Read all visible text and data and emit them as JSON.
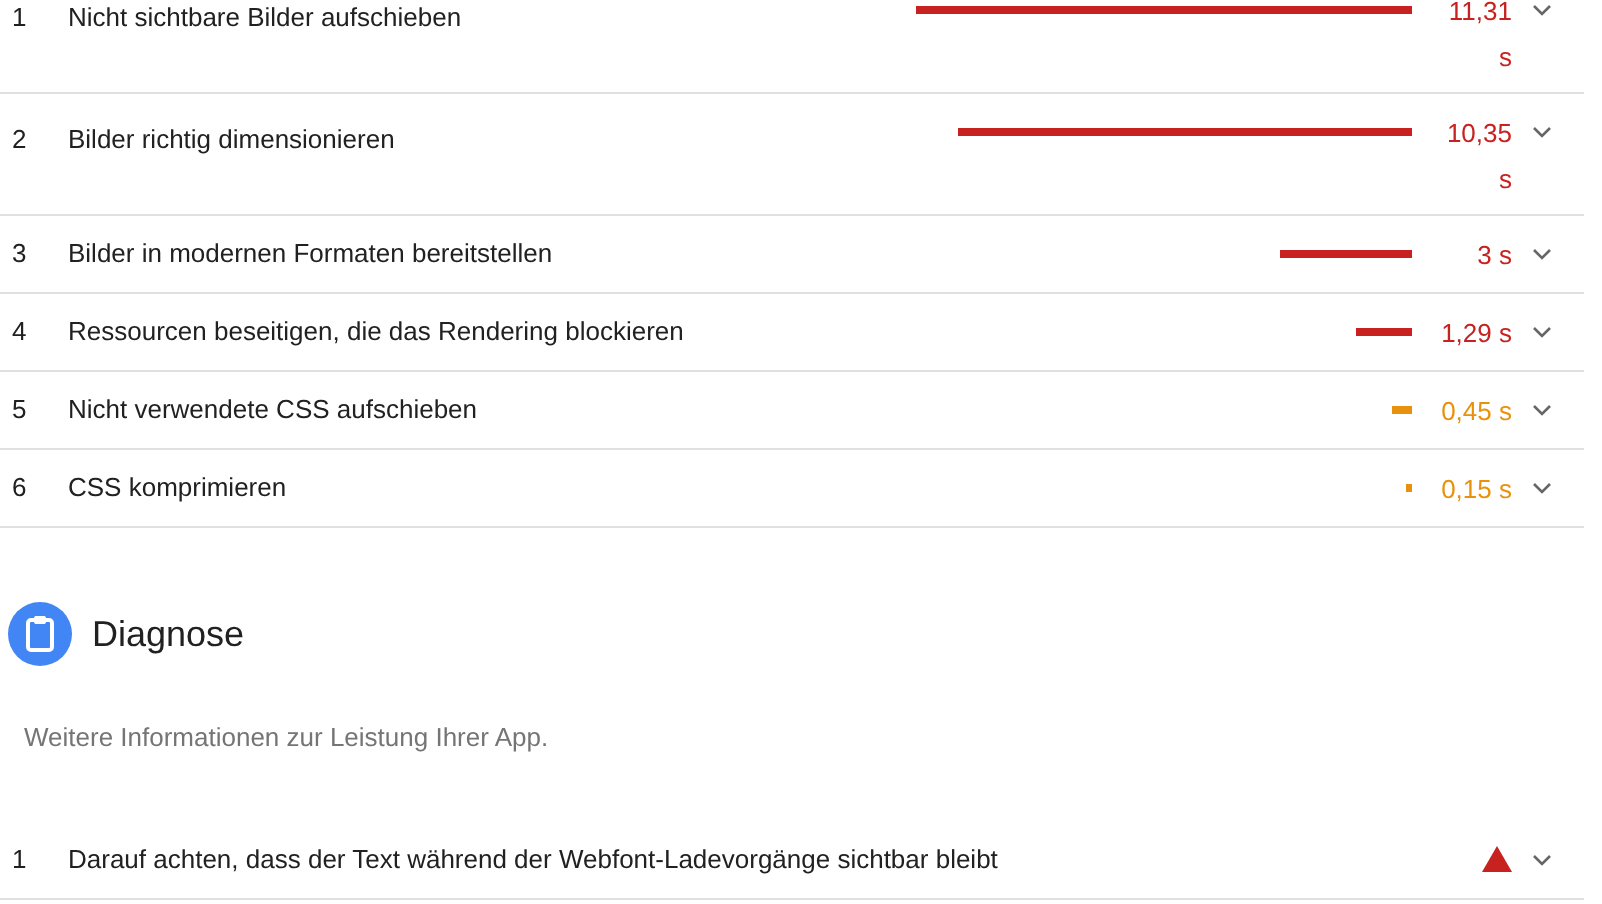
{
  "opportunities": [
    {
      "index": "1",
      "title": "Nicht sichtbare Bilder aufschieben",
      "value": "11,31 s",
      "color": "#c7221f",
      "expanded": false
    },
    {
      "index": "2",
      "title": "Bilder richtig dimensionieren",
      "value": "10,35 s",
      "color": "#c7221f",
      "expanded": false
    },
    {
      "index": "3",
      "title": "Bilder in modernen Formaten bereitstellen",
      "value": "3 s",
      "color": "#c7221f",
      "expanded": false
    },
    {
      "index": "4",
      "title": "Ressourcen beseitigen, die das Rendering blockieren",
      "value": "1,29 s",
      "color": "#c7221f",
      "expanded": false
    },
    {
      "index": "5",
      "title": "Nicht verwendete CSS aufschieben",
      "value": "0,45 s",
      "color": "#e8910c",
      "expanded": false
    },
    {
      "index": "6",
      "title": "CSS komprimieren",
      "value": "0,15 s",
      "color": "#e8910c",
      "expanded": false
    }
  ],
  "diagnostics": {
    "title": "Diagnose",
    "description": "Weitere Informationen zur Leistung Ihrer App.",
    "items": [
      {
        "index": "1",
        "title": "Darauf achten, dass der Text während der Webfont-Ladevorgänge sichtbar bleibt",
        "color": "#c7221f",
        "expanded": false
      }
    ]
  }
}
